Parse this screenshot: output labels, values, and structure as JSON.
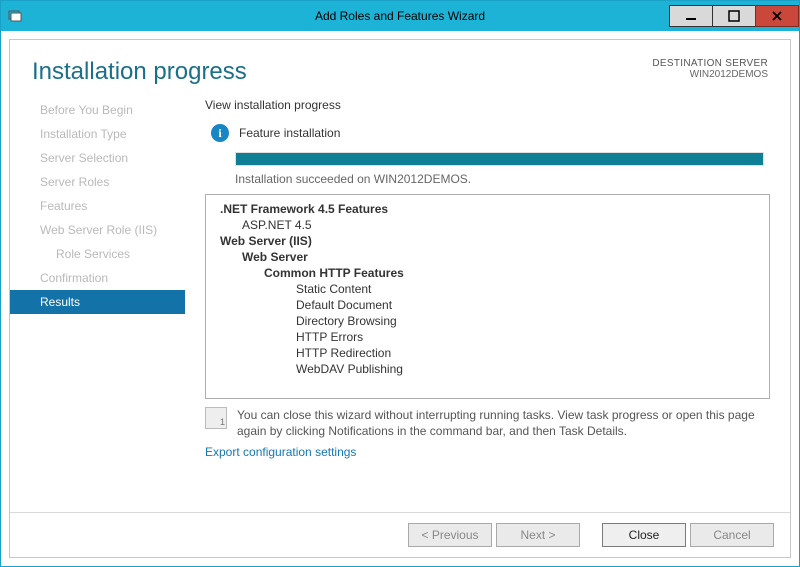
{
  "window": {
    "title": "Add Roles and Features Wizard"
  },
  "header": {
    "heading": "Installation progress",
    "destination_label": "DESTINATION SERVER",
    "destination_name": "WIN2012DEMOS"
  },
  "sidebar": {
    "steps": [
      {
        "label": "Before You Begin"
      },
      {
        "label": "Installation Type"
      },
      {
        "label": "Server Selection"
      },
      {
        "label": "Server Roles"
      },
      {
        "label": "Features"
      },
      {
        "label": "Web Server Role (IIS)"
      },
      {
        "label": "Role Services",
        "child": true
      },
      {
        "label": "Confirmation"
      },
      {
        "label": "Results",
        "active": true
      }
    ]
  },
  "main": {
    "view_label": "View installation progress",
    "status_text": "Feature installation",
    "succeed_msg": "Installation succeeded on WIN2012DEMOS.",
    "tree": [
      {
        "text": ".NET Framework 4.5 Features",
        "cls": "d0"
      },
      {
        "text": "ASP.NET 4.5",
        "cls": "d1n"
      },
      {
        "text": "Web Server (IIS)",
        "cls": "d0"
      },
      {
        "text": "Web Server",
        "cls": "d1"
      },
      {
        "text": "Common HTTP Features",
        "cls": "d2"
      },
      {
        "text": "Static Content",
        "cls": "d3"
      },
      {
        "text": "Default Document",
        "cls": "d3"
      },
      {
        "text": "Directory Browsing",
        "cls": "d3"
      },
      {
        "text": "HTTP Errors",
        "cls": "d3"
      },
      {
        "text": "HTTP Redirection",
        "cls": "d3"
      },
      {
        "text": "WebDAV Publishing",
        "cls": "d3"
      }
    ],
    "hint": "You can close this wizard without interrupting running tasks. View task progress or open this page again by clicking Notifications in the command bar, and then Task Details.",
    "export_link": "Export configuration settings"
  },
  "footer": {
    "previous": "< Previous",
    "next": "Next >",
    "close": "Close",
    "cancel": "Cancel"
  }
}
